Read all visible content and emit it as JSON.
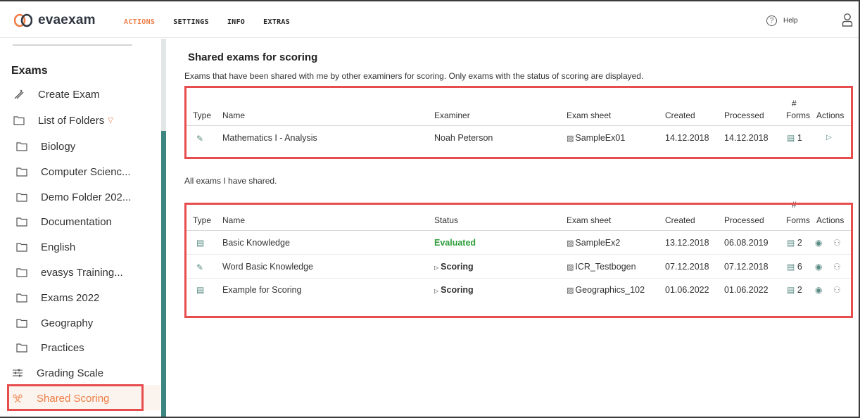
{
  "app": {
    "name": "evaexam"
  },
  "nav": [
    "ACTIONS",
    "SETTINGS",
    "INFO",
    "EXTRAS"
  ],
  "header": {
    "help_label": "Help"
  },
  "sidebar": {
    "title": "Exams",
    "create_exam": "Create Exam",
    "list_of_folders": "List of Folders",
    "folders": [
      "Biology",
      "Computer Scienc...",
      "Demo Folder 202...",
      "Documentation",
      "English",
      "evasys Training...",
      "Exams 2022",
      "Geography",
      "Practices"
    ],
    "grading_scale": "Grading Scale",
    "shared_scoring": "Shared Scoring"
  },
  "main": {
    "title": "Shared exams for scoring",
    "description": "Exams that have been shared with me by other examiners for scoring. Only exams with the status of scoring are displayed.",
    "subtitle": "All exams I have shared."
  },
  "table1": {
    "headers": {
      "type": "Type",
      "name": "Name",
      "examiner": "Examiner",
      "sheet": "Exam sheet",
      "created": "Created",
      "processed": "Processed",
      "forms_hash": "#",
      "forms": "Forms",
      "actions": "Actions"
    },
    "rows": [
      {
        "name": "Mathematics I - Analysis",
        "examiner": "Noah Peterson",
        "sheet": "SampleEx01",
        "created": "14.12.2018",
        "processed": "14.12.2018",
        "forms": "1"
      }
    ]
  },
  "table2": {
    "headers": {
      "type": "Type",
      "name": "Name",
      "status": "Status",
      "sheet": "Exam sheet",
      "created": "Created",
      "processed": "Processed",
      "forms_hash": "#",
      "forms": "Forms",
      "actions": "Actions"
    },
    "rows": [
      {
        "name": "Basic Knowledge",
        "status": "Evaluated",
        "sheet": "SampleEx2",
        "created": "13.12.2018",
        "processed": "06.08.2019",
        "forms": "2"
      },
      {
        "name": "Word Basic Knowledge",
        "status": "Scoring",
        "sheet": "ICR_Testbogen",
        "created": "07.12.2018",
        "processed": "07.12.2018",
        "forms": "6"
      },
      {
        "name": "Example for Scoring",
        "status": "Scoring",
        "sheet": "Geographics_102",
        "created": "01.06.2022",
        "processed": "01.06.2022",
        "forms": "2"
      }
    ]
  },
  "colors": {
    "accent": "#ef7d45",
    "teal": "#3d8580",
    "highlight": "#e84d4d",
    "evaluated": "#2e9e3a"
  }
}
